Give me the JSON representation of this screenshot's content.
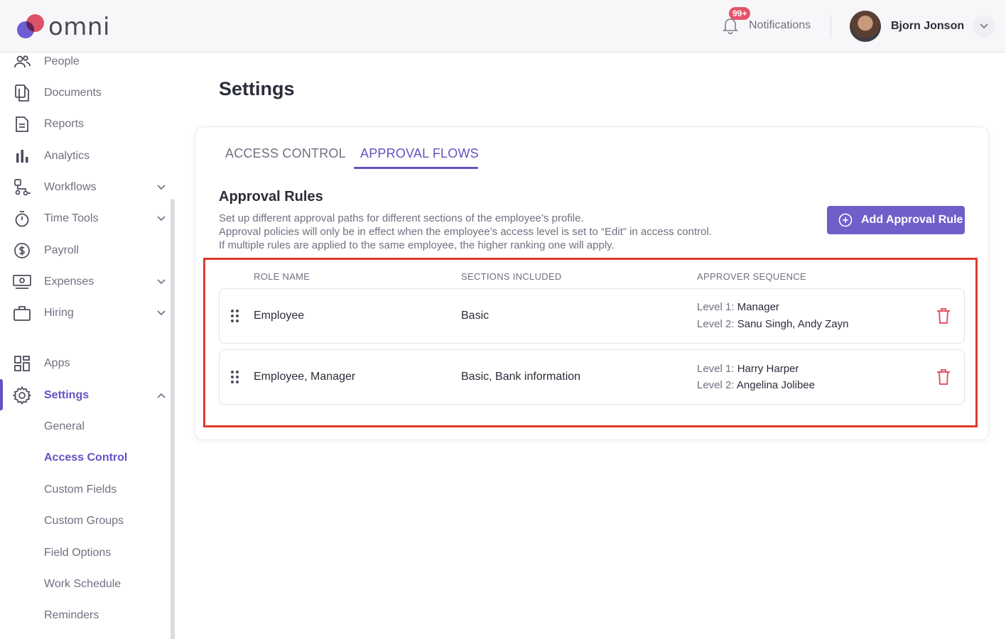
{
  "header": {
    "logo_text": "omni",
    "notifications": {
      "badge": "99+",
      "label": "Notifications"
    },
    "user": {
      "name": "Bjorn Jonson"
    }
  },
  "sidebar": {
    "items": [
      {
        "label": "People",
        "icon": "people-icon"
      },
      {
        "label": "Documents",
        "icon": "documents-icon"
      },
      {
        "label": "Reports",
        "icon": "reports-icon"
      },
      {
        "label": "Analytics",
        "icon": "analytics-icon"
      },
      {
        "label": "Workflows",
        "icon": "workflows-icon"
      },
      {
        "label": "Time Tools",
        "icon": "stopwatch-icon"
      },
      {
        "label": "Payroll",
        "icon": "dollar-icon"
      },
      {
        "label": "Expenses",
        "icon": "cash-icon"
      },
      {
        "label": "Hiring",
        "icon": "briefcase-icon"
      },
      {
        "label": "Apps",
        "icon": "apps-icon"
      },
      {
        "label": "Settings",
        "icon": "gear-icon"
      }
    ],
    "settings_sub": [
      "General",
      "Access Control",
      "Custom Fields",
      "Custom Groups",
      "Field Options",
      "Work Schedule",
      "Reminders"
    ]
  },
  "main": {
    "title": "Settings",
    "tabs": [
      "ACCESS CONTROL",
      "APPROVAL FLOWS"
    ],
    "section_title": "Approval Rules",
    "description": [
      "Set up different approval paths for different sections of the employee’s profile.",
      "Approval policies will only be in effect when the employee’s access level is set to “Edit” in access control.",
      "If multiple rules are applied to the same employee, the higher ranking one will apply."
    ],
    "add_button": "Add Approval Rule",
    "table": {
      "columns": [
        "ROLE NAME",
        "SECTIONS INCLUDED",
        "APPROVER SEQUENCE"
      ],
      "rows": [
        {
          "role": "Employee",
          "sections": "Basic",
          "levels": [
            {
              "key": "Level 1:",
              "value": "Manager"
            },
            {
              "key": "Level 2:",
              "value": "Sanu Singh, Andy Zayn"
            }
          ]
        },
        {
          "role": "Employee, Manager",
          "sections": "Basic, Bank information",
          "levels": [
            {
              "key": "Level 1:",
              "value": "Harry Harper"
            },
            {
              "key": "Level 2:",
              "value": "Angelina Jolibee"
            }
          ]
        }
      ]
    }
  },
  "colors": {
    "accent": "#6254c4",
    "button": "#6f5fc9",
    "danger": "#e5546a",
    "highlight": "#dd3b2c"
  }
}
